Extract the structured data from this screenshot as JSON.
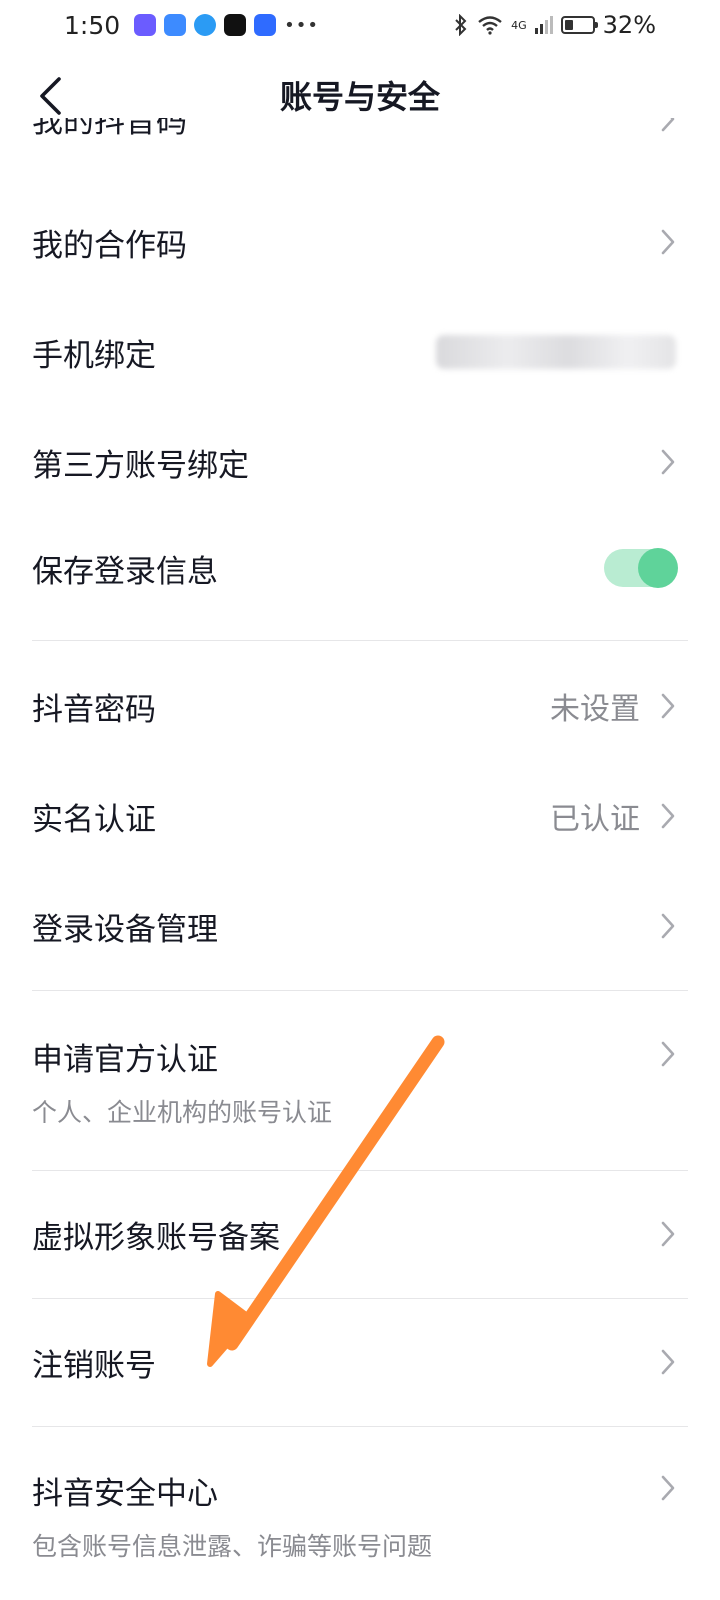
{
  "status_bar": {
    "time": "1:50",
    "network": "4G",
    "battery_percent": "32%",
    "battery_level": 0.32
  },
  "header": {
    "title": "账号与安全",
    "back_icon": "chevron-left-icon"
  },
  "list": {
    "partial_row_label": "我的抖音码",
    "rows": [
      {
        "label": "我的合作码"
      },
      {
        "label": "手机绑定"
      },
      {
        "label": "第三方账号绑定"
      },
      {
        "label": "保存登录信息",
        "toggle_on": true
      },
      {
        "label": "抖音密码",
        "value": "未设置"
      },
      {
        "label": "实名认证",
        "value": "已认证"
      },
      {
        "label": "登录设备管理"
      },
      {
        "label": "申请官方认证",
        "sub": "个人、企业机构的账号认证"
      },
      {
        "label": "虚拟形象账号备案"
      },
      {
        "label": "注销账号"
      },
      {
        "label": "抖音安全中心",
        "sub": "包含账号信息泄露、诈骗等账号问题"
      }
    ]
  },
  "colors": {
    "toggle_on": "#5fd39a",
    "annotation_arrow": "#ff8a33",
    "secondary_text": "#8a8b91"
  }
}
